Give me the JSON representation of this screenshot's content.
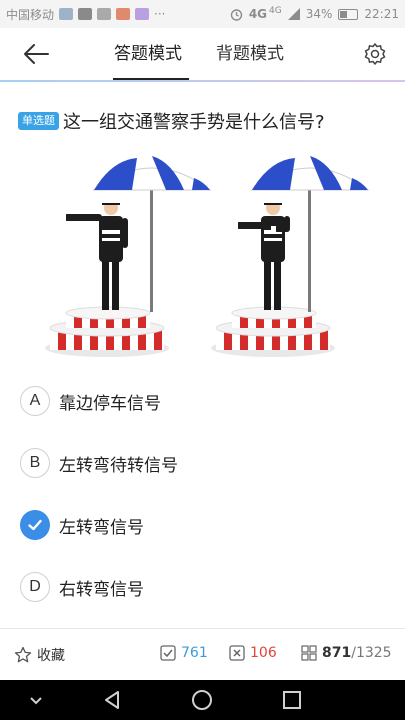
{
  "status_bar": {
    "carrier": "中国移动",
    "more": "···",
    "network": "4G",
    "network_sub": "4G",
    "battery": "34%",
    "time": "22:21"
  },
  "header": {
    "tabs": [
      {
        "label": "答题模式",
        "active": true
      },
      {
        "label": "背题模式",
        "active": false
      }
    ]
  },
  "question": {
    "type_badge": "单选题",
    "text": "这一组交通警察手势是什么信号?"
  },
  "options": [
    {
      "letter": "A",
      "text": "靠边停车信号",
      "selected": false
    },
    {
      "letter": "B",
      "text": "左转弯待转信号",
      "selected": false
    },
    {
      "letter": "C",
      "text": "左转弯信号",
      "selected": true
    },
    {
      "letter": "D",
      "text": "右转弯信号",
      "selected": false
    }
  ],
  "bottom_bar": {
    "favorite_label": "收藏",
    "correct_count": "761",
    "wrong_count": "106",
    "current_index": "871",
    "total": "/1325"
  },
  "colors": {
    "accent": "#3a8ee6",
    "badge": "#39a3e6",
    "correct": "#3a9bd8",
    "wrong": "#e0443f"
  }
}
